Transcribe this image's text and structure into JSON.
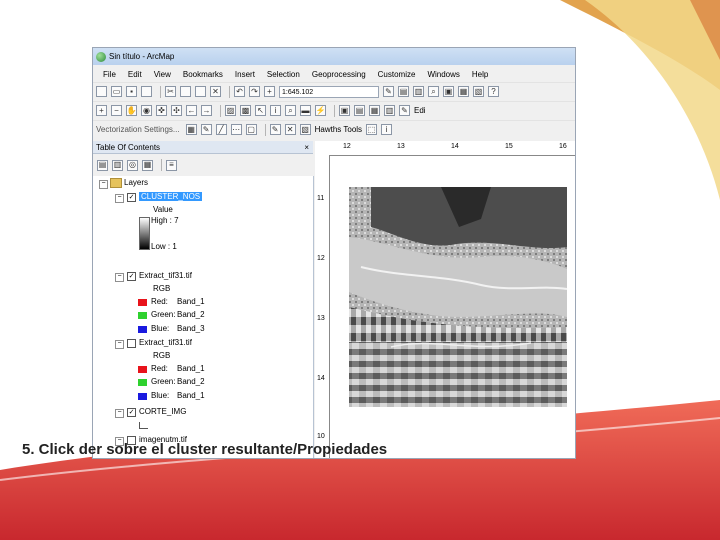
{
  "window": {
    "title": "Sin título - ArcMap"
  },
  "menu": [
    "File",
    "Edit",
    "View",
    "Bookmarks",
    "Insert",
    "Selection",
    "Geoprocessing",
    "Customize",
    "Windows",
    "Help"
  ],
  "toolbar": {
    "scale": "1:645.102",
    "vectorization_label": "Vectorization Settings...",
    "hawths_tools": "Hawths Tools",
    "edit_label": "Edi"
  },
  "toc": {
    "title": "Table Of Contents",
    "close": "×",
    "root": "Layers",
    "layers": [
      {
        "name": "CLUSTER_NOS",
        "value_label": "Value",
        "high": "High : 7",
        "low": "Low : 1"
      },
      {
        "name": "Extract_tif31.tif",
        "mode": "RGB",
        "bands": [
          {
            "label": "Red:",
            "band": "Band_1"
          },
          {
            "label": "Green:",
            "band": "Band_2"
          },
          {
            "label": "Blue:",
            "band": "Band_3"
          }
        ]
      },
      {
        "name": "Extract_tif31.tif",
        "mode": "RGB",
        "bands": [
          {
            "label": "Red:",
            "band": "Band_1"
          },
          {
            "label": "Green:",
            "band": "Band_2"
          },
          {
            "label": "Blue:",
            "band": "Band_1"
          }
        ]
      },
      {
        "name": "CORTE_IMG"
      },
      {
        "name": "imagenutm.tif"
      }
    ]
  },
  "map": {
    "ruler_top": [
      "12",
      "13",
      "14",
      "15",
      "16"
    ],
    "ruler_left": [
      "11",
      "12",
      "13",
      "14",
      "10"
    ]
  },
  "caption": "5. Click der sobre el cluster resultante/Propiedades",
  "colors": {
    "red": "#e8131b",
    "green": "#2ed12e",
    "blue": "#1a1adf",
    "selection": "#3399ff",
    "slide_accent": "#e94646"
  }
}
